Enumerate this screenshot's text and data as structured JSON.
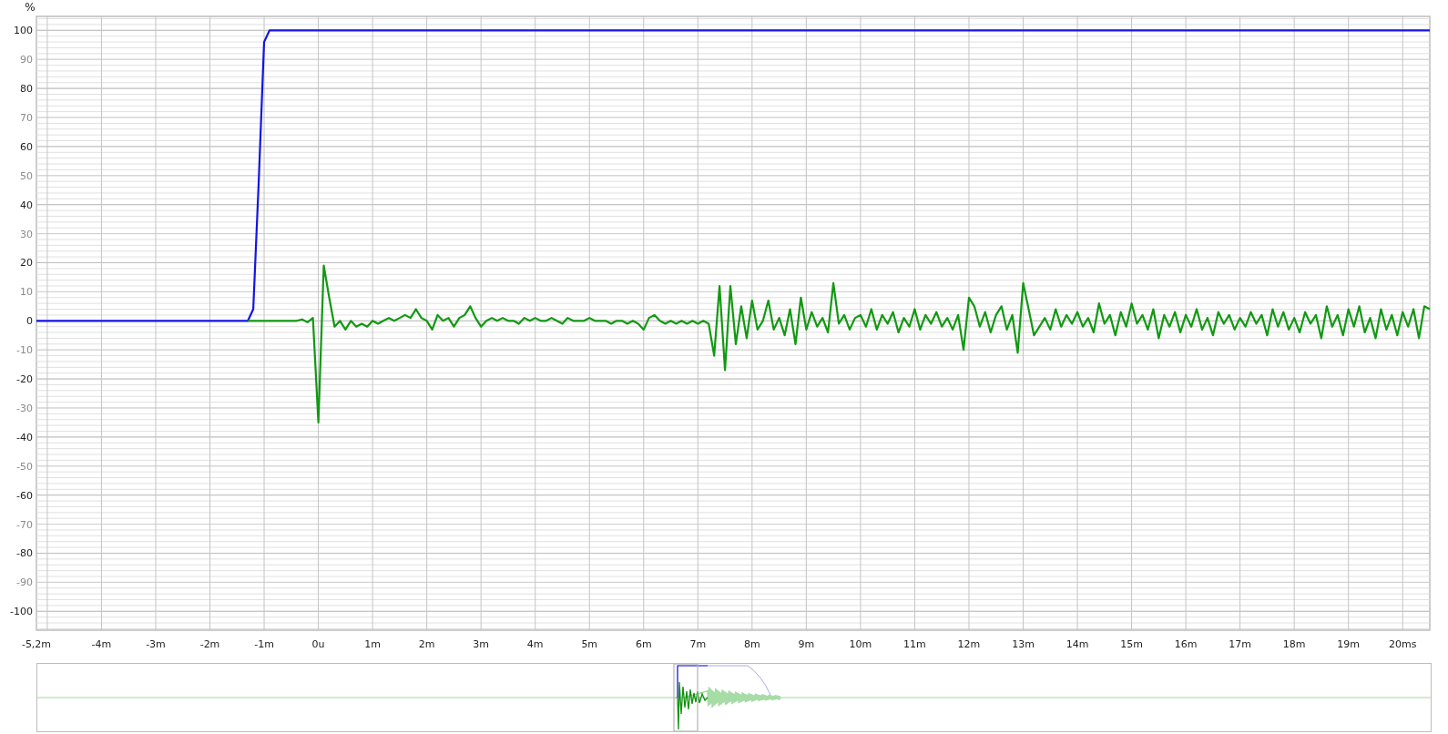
{
  "chart": {
    "y_unit": "%",
    "chart_data": {
      "type": "line",
      "x": [
        -5.2,
        -1.3,
        -1.2,
        -1.1,
        -1.0,
        -0.9,
        -0.8,
        -0.7,
        -0.6,
        -0.5,
        -0.4,
        -0.3,
        -0.2,
        -0.1,
        0.0,
        0.1,
        0.2,
        0.3,
        0.4,
        0.5,
        0.6,
        0.7,
        0.8,
        0.9,
        1.0,
        1.1,
        1.2,
        1.3,
        1.4,
        1.5,
        1.6,
        1.7,
        1.8,
        1.9,
        2.0,
        2.1,
        2.2,
        2.3,
        2.4,
        2.5,
        2.6,
        2.7,
        2.8,
        2.9,
        3.0,
        3.1,
        3.2,
        3.3,
        3.4,
        3.5,
        3.6,
        3.7,
        3.8,
        3.9,
        4.0,
        4.1,
        4.2,
        4.3,
        4.4,
        4.5,
        4.6,
        4.7,
        4.8,
        4.9,
        5.0,
        5.1,
        5.2,
        5.3,
        5.4,
        5.5,
        5.6,
        5.7,
        5.8,
        5.9,
        6.0,
        6.1,
        6.2,
        6.3,
        6.4,
        6.5,
        6.6,
        6.7,
        6.8,
        6.9,
        7.0,
        7.1,
        7.2,
        7.3,
        7.4,
        7.5,
        7.6,
        7.7,
        7.8,
        7.9,
        8.0,
        8.1,
        8.2,
        8.3,
        8.4,
        8.5,
        8.6,
        8.7,
        8.8,
        8.9,
        9.0,
        9.1,
        9.2,
        9.3,
        9.4,
        9.5,
        9.6,
        9.7,
        9.8,
        9.9,
        10.0,
        10.1,
        10.2,
        10.3,
        10.4,
        10.5,
        10.6,
        10.7,
        10.8,
        10.9,
        11.0,
        11.1,
        11.2,
        11.3,
        11.4,
        11.5,
        11.6,
        11.7,
        11.8,
        11.9,
        12.0,
        12.1,
        12.2,
        12.3,
        12.4,
        12.5,
        12.6,
        12.7,
        12.8,
        12.9,
        13.0,
        13.1,
        13.2,
        13.3,
        13.4,
        13.5,
        13.6,
        13.7,
        13.8,
        13.9,
        14.0,
        14.1,
        14.2,
        14.3,
        14.4,
        14.5,
        14.6,
        14.7,
        14.8,
        14.9,
        15.0,
        15.1,
        15.2,
        15.3,
        15.4,
        15.5,
        15.6,
        15.7,
        15.8,
        15.9,
        16.0,
        16.1,
        16.2,
        16.3,
        16.4,
        16.5,
        16.6,
        16.7,
        16.8,
        16.9,
        17.0,
        17.1,
        17.2,
        17.3,
        17.4,
        17.5,
        17.6,
        17.7,
        17.8,
        17.9,
        18.0,
        18.1,
        18.2,
        18.3,
        18.4,
        18.5,
        18.6,
        18.7,
        18.8,
        18.9,
        19.0,
        19.1,
        19.2,
        19.3,
        19.4,
        19.5,
        19.6,
        19.7,
        19.8,
        19.9,
        20.0,
        20.1,
        20.2,
        20.3,
        20.4,
        20.5
      ],
      "series": [
        {
          "color": "#1414e6",
          "values": [
            0,
            0,
            4,
            48,
            96,
            100,
            100,
            100,
            100,
            100,
            100,
            100,
            100,
            100,
            100,
            100,
            100,
            100,
            100,
            100,
            100,
            100,
            100,
            100,
            100,
            100,
            100,
            100,
            100,
            100,
            100,
            100,
            100,
            100,
            100,
            100,
            100,
            100,
            100,
            100,
            100,
            100,
            100,
            100,
            100,
            100,
            100,
            100,
            100,
            100,
            100,
            100,
            100,
            100,
            100,
            100,
            100,
            100,
            100,
            100,
            100,
            100,
            100,
            100,
            100,
            100,
            100,
            100,
            100,
            100,
            100,
            100,
            100,
            100,
            100,
            100,
            100,
            100,
            100,
            100,
            100,
            100,
            100,
            100,
            100,
            100,
            100,
            100,
            100,
            100,
            100,
            100,
            100,
            100,
            100,
            100,
            100,
            100,
            100,
            100,
            100,
            100,
            100,
            100,
            100,
            100,
            100,
            100,
            100,
            100,
            100,
            100,
            100,
            100,
            100,
            100,
            100,
            100,
            100,
            100,
            100,
            100,
            100,
            100,
            100,
            100,
            100,
            100,
            100,
            100,
            100,
            100,
            100,
            100,
            100,
            100,
            100,
            100,
            100,
            100,
            100,
            100,
            100,
            100,
            100,
            100,
            100,
            100,
            100,
            100,
            100,
            100,
            100,
            100,
            100,
            100,
            100,
            100,
            100,
            100,
            100,
            100,
            100,
            100,
            100,
            100,
            100,
            100,
            100,
            100,
            100,
            100,
            100,
            100,
            100,
            100,
            100,
            100,
            100,
            100,
            100,
            100,
            100,
            100,
            100,
            100,
            100,
            100,
            100,
            100,
            100,
            100,
            100,
            100,
            100,
            100,
            100,
            100,
            100,
            100,
            100,
            100,
            100,
            100,
            100,
            100,
            100,
            100,
            100,
            100,
            100,
            100,
            100,
            100,
            100,
            100,
            100,
            100,
            100,
            100
          ]
        },
        {
          "color": "#119911",
          "values": [
            null,
            0,
            0,
            0,
            0,
            0,
            0,
            0,
            0,
            0,
            0,
            0.5,
            -0.5,
            1,
            -35,
            19,
            8,
            -2,
            0,
            -3,
            0,
            -2,
            -1,
            -2,
            0,
            -1,
            0,
            1,
            0,
            1,
            2,
            1,
            4,
            1,
            0,
            -3,
            2,
            0,
            1,
            -2,
            1,
            2,
            5,
            1,
            -2,
            0,
            1,
            0,
            1,
            0,
            0,
            -1,
            1,
            0,
            1,
            0,
            0,
            1,
            0,
            -1,
            1,
            0,
            0,
            0,
            1,
            0,
            0,
            0,
            -1,
            0,
            0,
            -1,
            0,
            -1,
            -3,
            1,
            2,
            0,
            -1,
            0,
            -1,
            0,
            -1,
            0,
            -1,
            0,
            -1,
            -12,
            12,
            -17,
            12,
            -8,
            5,
            -6,
            7,
            -3,
            0,
            7,
            -3,
            1,
            -5,
            4,
            -8,
            8,
            -3,
            3,
            -2,
            1,
            -4,
            13,
            -1,
            2,
            -3,
            1,
            2,
            -2,
            4,
            -3,
            2,
            -1,
            3,
            -4,
            1,
            -2,
            4,
            -3,
            2,
            -1,
            3,
            -2,
            1,
            -3,
            2,
            -10,
            8,
            5,
            -2,
            3,
            -4,
            2,
            5,
            -3,
            2,
            -11,
            13,
            4,
            -5,
            -2,
            1,
            -3,
            4,
            -2,
            2,
            -1,
            3,
            -2,
            1,
            -4,
            6,
            -1,
            2,
            -5,
            3,
            -2,
            6,
            -1,
            2,
            -3,
            4,
            -6,
            2,
            -2,
            3,
            -4,
            2,
            -2,
            4,
            -3,
            1,
            -5,
            3,
            -1,
            2,
            -3,
            1,
            -2,
            3,
            -1,
            2,
            -5,
            4,
            -2,
            3,
            -3,
            1,
            -4,
            3,
            -1,
            2,
            -6,
            5,
            -2,
            2,
            -5,
            4,
            -2,
            5,
            -4,
            1,
            -6,
            4,
            -3,
            2,
            -5,
            3,
            -2,
            4,
            -6,
            5,
            4
          ]
        }
      ],
      "grid": true,
      "xlim": [
        -5.2,
        20.5
      ],
      "ylim": [
        -106.5,
        104.8
      ],
      "xticks": [
        {
          "value": -5.2,
          "label": "-5,2m"
        },
        {
          "value": -4,
          "label": "-4m"
        },
        {
          "value": -3,
          "label": "-3m"
        },
        {
          "value": -2,
          "label": "-2m"
        },
        {
          "value": -1,
          "label": "-1m"
        },
        {
          "value": 0,
          "label": "0u"
        },
        {
          "value": 1,
          "label": "1m"
        },
        {
          "value": 2,
          "label": "2m"
        },
        {
          "value": 3,
          "label": "3m"
        },
        {
          "value": 4,
          "label": "4m"
        },
        {
          "value": 5,
          "label": "5m"
        },
        {
          "value": 6,
          "label": "6m"
        },
        {
          "value": 7,
          "label": "7m"
        },
        {
          "value": 8,
          "label": "8m"
        },
        {
          "value": 9,
          "label": "9m"
        },
        {
          "value": 10,
          "label": "10m"
        },
        {
          "value": 11,
          "label": "11m"
        },
        {
          "value": 12,
          "label": "12m"
        },
        {
          "value": 13,
          "label": "13m"
        },
        {
          "value": 14,
          "label": "14m"
        },
        {
          "value": 15,
          "label": "15m"
        },
        {
          "value": 16,
          "label": "16m"
        },
        {
          "value": 17,
          "label": "17m"
        },
        {
          "value": 18,
          "label": "18m"
        },
        {
          "value": 19,
          "label": "19m"
        },
        {
          "value": 20,
          "label": "20ms"
        }
      ],
      "yticks": [
        100,
        90,
        80,
        70,
        60,
        50,
        40,
        30,
        20,
        10,
        0,
        -10,
        -20,
        -30,
        -40,
        -50,
        -60,
        -70,
        -80,
        -90,
        -100
      ]
    }
  }
}
